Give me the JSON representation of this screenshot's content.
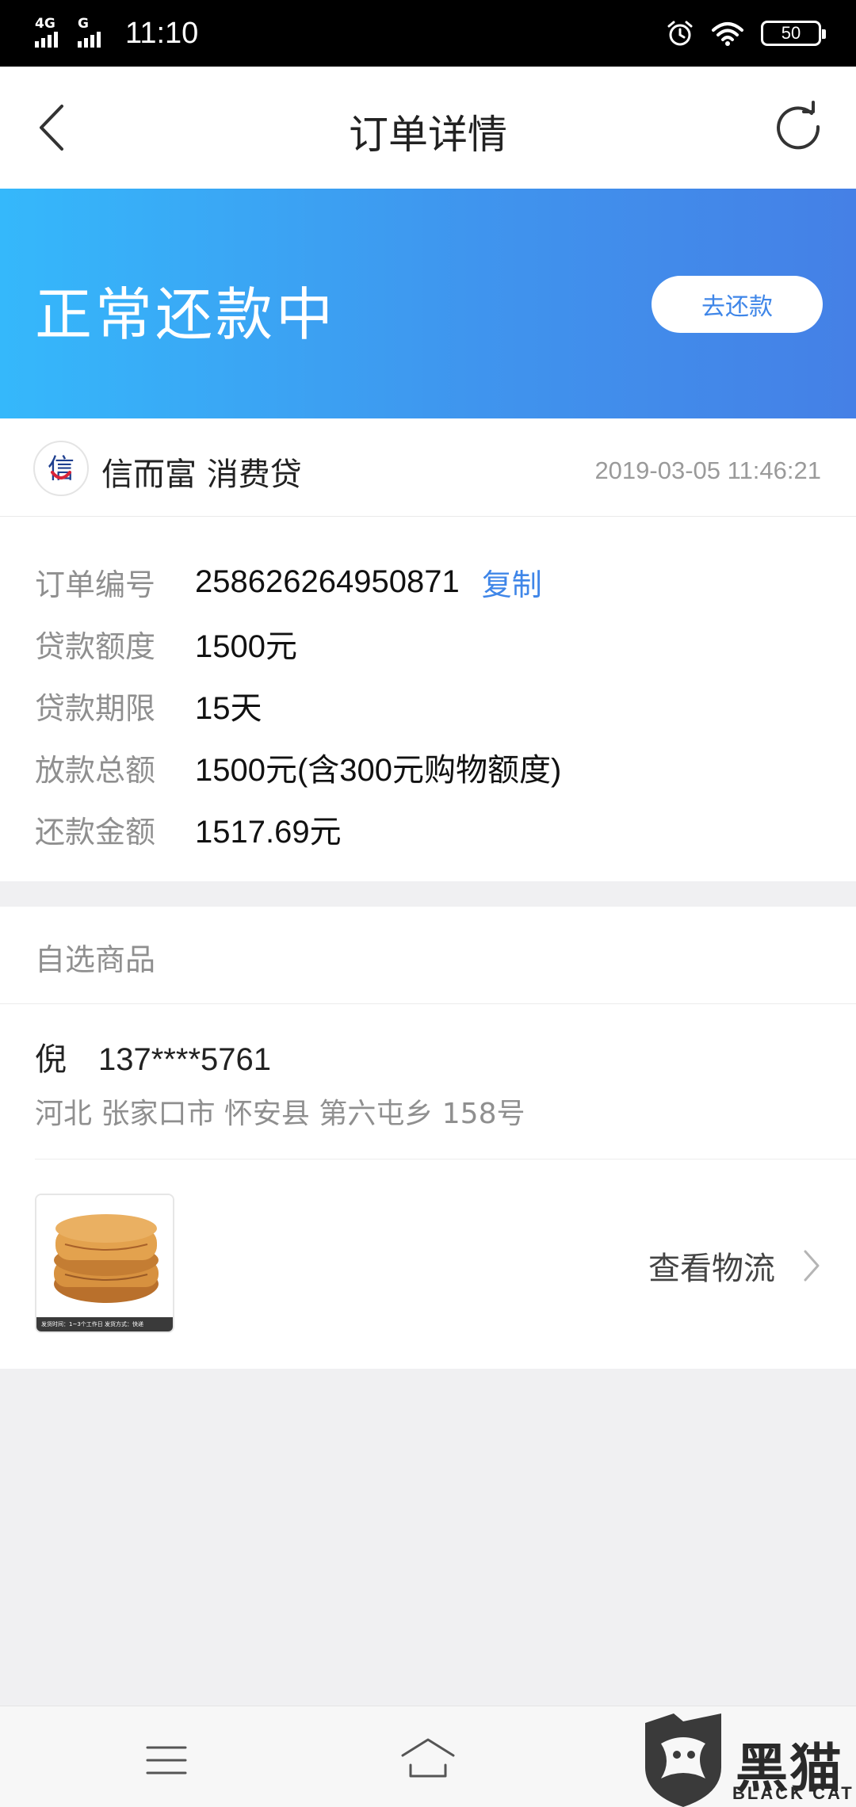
{
  "status_bar": {
    "network_1": "4G",
    "network_2": "G",
    "time": "11:10",
    "battery": "50"
  },
  "nav": {
    "title": "订单详情"
  },
  "banner": {
    "status": "正常还款中",
    "repay_button": "去还款"
  },
  "merchant": {
    "logo_char": "信",
    "name": "信而富 消费贷",
    "timestamp": "2019-03-05 11:46:21"
  },
  "details": {
    "rows": [
      {
        "label": "订单编号",
        "value": "258626264950871"
      },
      {
        "label": "贷款额度",
        "value": "1500元"
      },
      {
        "label": "贷款期限",
        "value": "15天"
      },
      {
        "label": "放款总额",
        "value": "1500元(含300元购物额度)"
      },
      {
        "label": "还款金额",
        "value": "1517.69元"
      }
    ],
    "copy_label": "复制"
  },
  "products": {
    "section_title": "自选商品",
    "recipient_name": "倪",
    "recipient_phone": "137****5761",
    "address": "河北 张家口市 怀安县 第六屯乡 158号",
    "thumb_caption": "发货时间：1~3个工作日 发货方式：快递",
    "logistics_label": "查看物流"
  },
  "watermark": {
    "text": "黑猫",
    "sub": "BLACK CAT"
  },
  "colors": {
    "accent": "#3f86e8",
    "banner_start": "#35b8fb",
    "banner_end": "#4580e6"
  }
}
